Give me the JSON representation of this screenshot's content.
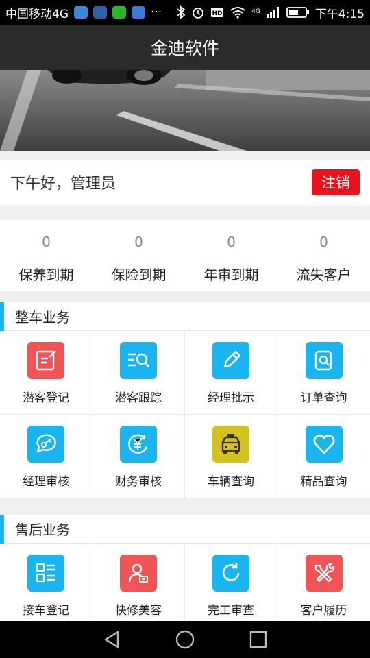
{
  "status_bar": {
    "carrier": "中国移动4G",
    "more": "···",
    "network": "4G",
    "time": "下午4:15"
  },
  "title": "金迪软件",
  "greeting": {
    "text": "下午好，管理员",
    "logout_label": "注销"
  },
  "stats": [
    {
      "value": "0",
      "label": "保养到期"
    },
    {
      "value": "0",
      "label": "保险到期"
    },
    {
      "value": "0",
      "label": "年审到期"
    },
    {
      "value": "0",
      "label": "流失客户"
    }
  ],
  "sections": [
    {
      "title": "整车业务",
      "items": [
        {
          "label": "潜客登记",
          "icon": "edit-note-icon",
          "color": "#f05454"
        },
        {
          "label": "潜客跟踪",
          "icon": "list-search-icon",
          "color": "#1ab4ee"
        },
        {
          "label": "经理批示",
          "icon": "pencil-icon",
          "color": "#1ab4ee"
        },
        {
          "label": "订单查询",
          "icon": "document-search-icon",
          "color": "#1ab4ee"
        },
        {
          "label": "经理审核",
          "icon": "chat-key-icon",
          "color": "#1ab4ee"
        },
        {
          "label": "财务审核",
          "icon": "yuan-refresh-icon",
          "color": "#1ab4ee"
        },
        {
          "label": "车辆查询",
          "icon": "taxi-icon",
          "color": "#d4c01e"
        },
        {
          "label": "精品查询",
          "icon": "heart-icon",
          "color": "#1ab4ee"
        }
      ]
    },
    {
      "title": "售后业务",
      "items": [
        {
          "label": "接车登记",
          "icon": "checklist-icon",
          "color": "#1ab4ee"
        },
        {
          "label": "快修美容",
          "icon": "user-card-icon",
          "color": "#f05454"
        },
        {
          "label": "完工审查",
          "icon": "refresh-icon",
          "color": "#1ab4ee"
        },
        {
          "label": "客户履历",
          "icon": "tools-icon",
          "color": "#f05454"
        }
      ]
    }
  ],
  "colors": {
    "accent": "#1ab4ee",
    "danger": "#e8141b",
    "active_dot": "#e8c21b"
  }
}
